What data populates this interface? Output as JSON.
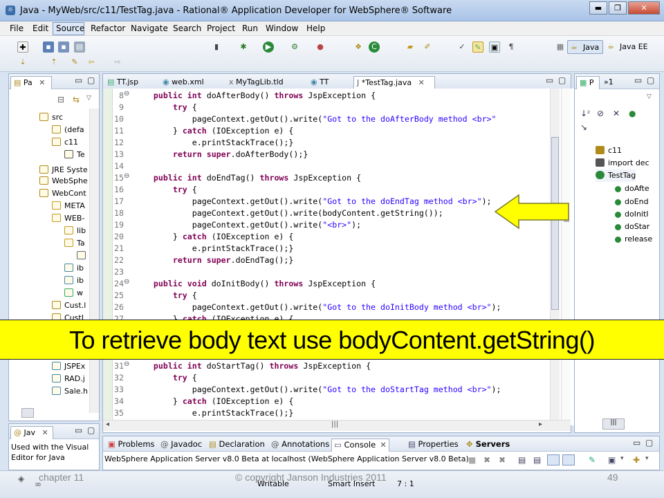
{
  "window": {
    "title": "Java - MyWeb/src/c11/TestTag.java - Rational® Application Developer for WebSphere® Software",
    "controls": [
      "▬",
      "❐",
      "✕"
    ]
  },
  "menubar": [
    "File",
    "Edit",
    "Source",
    "Refactor",
    "Navigate",
    "Search",
    "Project",
    "Run",
    "Window",
    "Help"
  ],
  "perspectives": {
    "java": "Java",
    "java_ee": "Java EE"
  },
  "left_pane": {
    "tab": "Pa",
    "tree": [
      {
        "label": "src"
      },
      {
        "label": "(defa"
      },
      {
        "label": "c11"
      },
      {
        "label": "Te"
      },
      {
        "label": "JRE Syste"
      },
      {
        "label": "WebSphe"
      },
      {
        "label": "WebCont"
      },
      {
        "label": "META"
      },
      {
        "label": "WEB-"
      },
      {
        "label": "lib"
      },
      {
        "label": "Ta"
      },
      {
        "label": "x"
      },
      {
        "label": "ib"
      },
      {
        "label": "ib"
      },
      {
        "label": "w"
      },
      {
        "label": "Cust.l"
      },
      {
        "label": "CustJ"
      },
      {
        "label": "Funct"
      },
      {
        "label": "JSPEx"
      },
      {
        "label": "RAD.j"
      },
      {
        "label": "Sale.h"
      }
    ]
  },
  "javadoc_pane": {
    "tab": "Jav",
    "text": "Used with the Visual Editor for Java"
  },
  "editor": {
    "tabs": [
      {
        "label": "TT.jsp",
        "active": false
      },
      {
        "label": "web.xml",
        "active": false
      },
      {
        "label": "MyTagLib.tld",
        "active": false
      },
      {
        "label": "TT",
        "active": false
      },
      {
        "label": "*TestTag.java",
        "active": true
      }
    ],
    "lines": [
      {
        "n": "8",
        "code": "    public int doAfterBody() throws JspException {"
      },
      {
        "n": "9",
        "code": "        try {"
      },
      {
        "n": "10",
        "code": "            pageContext.getOut().write(\"Got to the doAfterBody method <br>\""
      },
      {
        "n": "11",
        "code": "        } catch (IOException e) {"
      },
      {
        "n": "12",
        "code": "            e.printStackTrace();}"
      },
      {
        "n": "13",
        "code": "        return super.doAfterBody();}"
      },
      {
        "n": "14",
        "code": ""
      },
      {
        "n": "15",
        "code": "    public int doEndTag() throws JspException {"
      },
      {
        "n": "16",
        "code": "        try {"
      },
      {
        "n": "17",
        "code": "            pageContext.getOut().write(\"Got to the doEndTag method <br>\");"
      },
      {
        "n": "18",
        "code": "            pageContext.getOut().write(bodyContent.getString());"
      },
      {
        "n": "19",
        "code": "            pageContext.getOut().write(\"<br>\");"
      },
      {
        "n": "20",
        "code": "        } catch (IOException e) {"
      },
      {
        "n": "21",
        "code": "            e.printStackTrace();}"
      },
      {
        "n": "22",
        "code": "        return super.doEndTag();}"
      },
      {
        "n": "23",
        "code": ""
      },
      {
        "n": "24",
        "code": "    public void doInitBody() throws JspException {"
      },
      {
        "n": "25",
        "code": "        try {"
      },
      {
        "n": "26",
        "code": "            pageContext.getOut().write(\"Got to the doInitBody method <br>\");"
      },
      {
        "n": "27",
        "code": "        } catch (IOException e) {"
      },
      {
        "n": "28",
        "code": ""
      },
      {
        "n": "29",
        "code": ""
      },
      {
        "n": "30",
        "code": ""
      },
      {
        "n": "31",
        "code": "    public int doStartTag() throws JspException {"
      },
      {
        "n": "32",
        "code": "        try {"
      },
      {
        "n": "33",
        "code": "            pageContext.getOut().write(\"Got to the doStartTag method <br>\");"
      },
      {
        "n": "34",
        "code": "        } catch (IOException e) {"
      },
      {
        "n": "35",
        "code": "            e.printStackTrace();}"
      }
    ]
  },
  "outline_pane": {
    "tabs": [
      "P",
      "»1"
    ],
    "items": [
      {
        "label": "c11"
      },
      {
        "label": "import dec"
      },
      {
        "label": "TestTag"
      },
      {
        "label": "doAfte"
      },
      {
        "label": "doEnd"
      },
      {
        "label": "doInitI"
      },
      {
        "label": "doStar"
      },
      {
        "label": "release"
      }
    ]
  },
  "bottom_pane": {
    "tabs": [
      "Problems",
      "Javadoc",
      "Declaration",
      "Annotations",
      "Console",
      "Properties",
      "Servers"
    ],
    "server_text": "WebSphere Application Server v8.0 Beta at localhost (WebSphere Application Server v8.0 Beta)"
  },
  "statusbar": {
    "writable": "Writable",
    "insert": "Smart Insert",
    "position": "7 : 1"
  },
  "banner": {
    "text": "To retrieve body text use bodyContent.getString()"
  },
  "footer": {
    "left": "chapter 11",
    "center": "© copyright Janson Industries 2011",
    "right": "49"
  },
  "colors": {
    "banner_bg": "#ffff00",
    "arrow": "#ffff00",
    "keyword": "#7f0055",
    "string": "#2a00ff"
  }
}
